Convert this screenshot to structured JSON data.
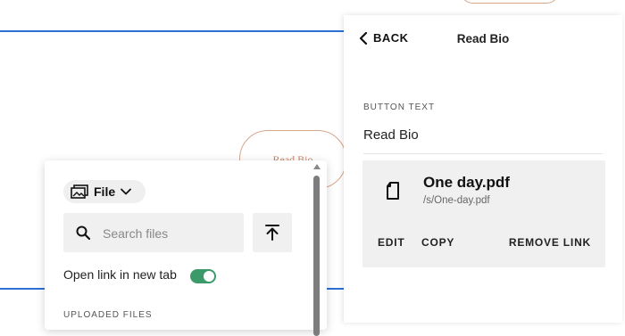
{
  "canvas": {
    "button_label": "Read Bio",
    "accent_color": "#2d6fd4"
  },
  "link_panel": {
    "back_label": "BACK",
    "title": "Read Bio",
    "button_text_label": "BUTTON TEXT",
    "button_text_value": "Read Bio",
    "file": {
      "name": "One day.pdf",
      "path": "/s/One-day.pdf",
      "icon": "document-icon"
    },
    "actions": {
      "edit": "EDIT",
      "copy": "COPY",
      "remove": "REMOVE LINK"
    }
  },
  "file_picker": {
    "type_selector": "File",
    "type_icon": "images-icon",
    "search_placeholder": "Search files",
    "search_value": "",
    "upload_icon": "upload-icon",
    "open_new_tab_label": "Open link in new tab",
    "open_new_tab_on": true,
    "toggle_color": "#3c9a6a",
    "uploaded_files_label": "UPLOADED FILES"
  }
}
